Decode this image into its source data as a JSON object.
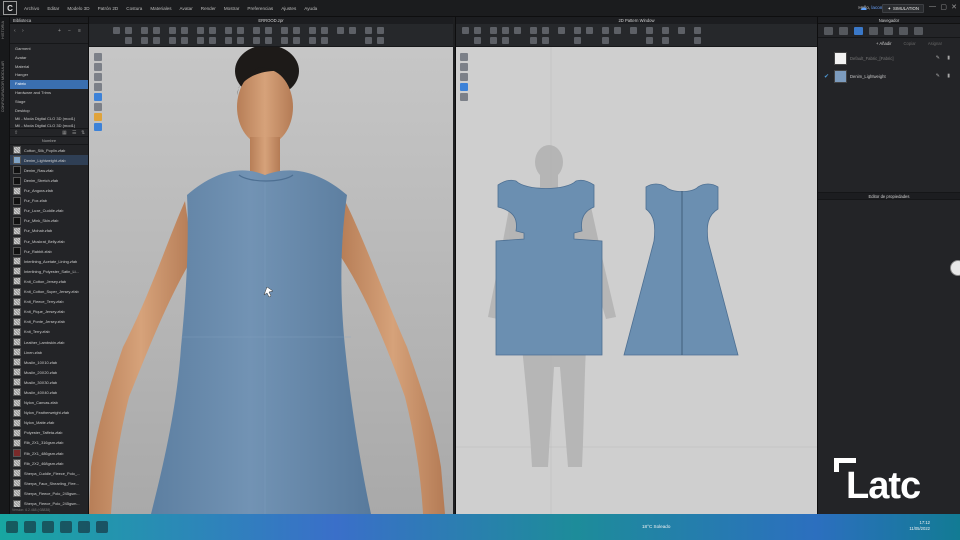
{
  "app": {
    "logo_letter": "C",
    "menu": [
      "Archivo",
      "Editar",
      "Modelo 3D",
      "Patrón 2D",
      "Costura",
      "Materiales",
      "Avatar",
      "Render",
      "Mostrar",
      "Preferencias",
      "Ajustes",
      "Ayuda"
    ],
    "user_greeting": "Hello,",
    "user_name": "lacomcreation",
    "mode_badge": "SIMULATION",
    "win_min": "—",
    "win_max": "▢",
    "win_close": "✕"
  },
  "vertical_tabs": [
    "HISTORIA",
    "CONFIGURADOR MODULAR"
  ],
  "library": {
    "title": "Biblioteca",
    "categories": [
      "Garment",
      "Avatar",
      "Material",
      "Hanger",
      "Fabric",
      "Hardware and Trims",
      "Stage",
      "Desktop",
      "Mil - Moda Digital CLO 3D (mod1)",
      "Mil - Moda Digital CLO 3D (mod1)"
    ],
    "selected_category": 4,
    "column_header": "Nombre",
    "files": [
      "Cotton_Silk_Poplin.zfab",
      "Denim_Lightweight.zfab",
      "Denim_Raw.zfab",
      "Denim_Stretch.zfab",
      "Fur_Angora.zfab",
      "Fur_Fox.zfab",
      "Fur_Luxe_Cuddle.zfab",
      "Fur_Mink_Skin.zfab",
      "Fur_Mohair.zfab",
      "Fur_Muskrat_Belly.zfab",
      "Fur_Rabbit.zfab",
      "Interlining_Acetate_Lining.zfab",
      "Interlining_Polyester_Satin_Li...",
      "Knit_Cotton_Jersey.zfab",
      "Knit_Cotton_Super_Jersey.zfab",
      "Knit_Fleece_Terry.zfab",
      "Knit_Pique_Jersey.zfab",
      "Knit_Ponte_Jersey.zfab",
      "Knit_Terry.zfab",
      "Leather_Lambskin.zfab",
      "Linen.zfab",
      "Muslin_10X10.zfab",
      "Muslin_20X20.zfab",
      "Muslin_30X30.zfab",
      "Muslin_40X40.zfab",
      "Nylon_Canvas.zfab",
      "Nylon_Featherweight.zfab",
      "Nylon_Matte.zfab",
      "Polyester_Taffeta.zfab",
      "Rib_2X1_316gsm.zfab",
      "Rib_2X1_486gsm.zfab",
      "Rib_2X2_468gsm.zfab",
      "Sherpa_Cuddle_Fleece_Polo_...",
      "Sherpa_Faux_Shearling_Flee...",
      "Sherpa_Fleece_Polo_245gsm...",
      "Sherpa_Fleece_Polo_245gsm..."
    ],
    "selected_file": 1,
    "version_label": "Version: 6.2.468 (r38838)"
  },
  "viewport_3d": {
    "title": "ERROOD.zpr"
  },
  "viewport_2d": {
    "title": "2D Pattern Window"
  },
  "navigator": {
    "title": "Navegador",
    "add_label": "+ Añadir",
    "copy_label": "Copiar",
    "assign_label": "Asignar",
    "fabrics": [
      {
        "name": "Default_Fabric_[Fabric]",
        "swatch": "#f2f2f2",
        "checked": false
      },
      {
        "name": "Denim_Lightweight",
        "swatch": "#7c9bbd",
        "checked": true
      }
    ],
    "properties_title": "Editor de propiedades"
  },
  "colors": {
    "garment": "#6b8fb1",
    "garment_edge": "#4d6f92",
    "accent": "#3a6fb0"
  },
  "taskbar": {
    "weather": "18°C  Soleado",
    "time": "17:12",
    "date": "11/05/2022"
  },
  "watermark": {
    "word": "Latc"
  }
}
